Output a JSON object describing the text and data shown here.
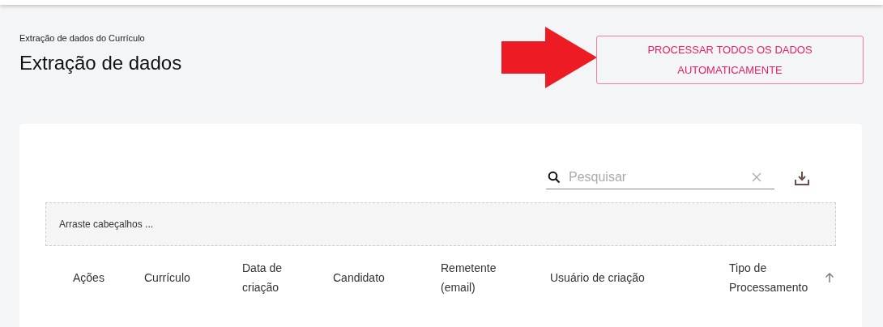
{
  "breadcrumb": "Extração de dados do Currículo",
  "title": "Extração de dados",
  "process_button": "PROCESSAR TODOS OS DADOS AUTOMATICAMENTE",
  "search": {
    "placeholder": "Pesquisar"
  },
  "group_panel": "Arraste cabeçalhos ...",
  "columns": [
    {
      "label": "Ações",
      "sorted": false
    },
    {
      "label": "Currículo",
      "sorted": false
    },
    {
      "label": "Data de criação",
      "sorted": false
    },
    {
      "label": "Candidato",
      "sorted": false
    },
    {
      "label": "Remetente (email)",
      "sorted": false
    },
    {
      "label": "Usuário de criação",
      "sorted": false
    },
    {
      "label": "Tipo de Processamento",
      "sorted": true
    }
  ]
}
